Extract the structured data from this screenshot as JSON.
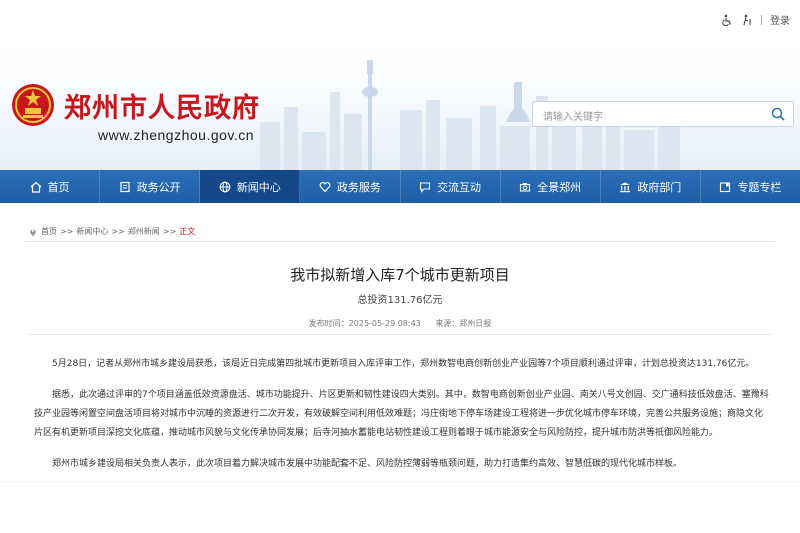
{
  "top_tools": {
    "accessibility_label": "",
    "login_label": "登录"
  },
  "header": {
    "site_title": "郑州市人民政府",
    "site_url": "www.zhengzhou.gov.cn"
  },
  "search": {
    "placeholder": "请输入关键字"
  },
  "nav": {
    "items": [
      {
        "label": "首页",
        "icon": "home-icon"
      },
      {
        "label": "政务公开",
        "icon": "document-icon"
      },
      {
        "label": "新闻中心",
        "icon": "globe-icon"
      },
      {
        "label": "政务服务",
        "icon": "heart-icon"
      },
      {
        "label": "交流互动",
        "icon": "chat-icon"
      },
      {
        "label": "全景郑州",
        "icon": "camera-icon"
      },
      {
        "label": "政府部门",
        "icon": "building-icon"
      },
      {
        "label": "专题专栏",
        "icon": "bookmark-icon"
      }
    ],
    "active_index": 2
  },
  "breadcrumb": {
    "items": [
      "首页",
      "新闻中心",
      "郑州新闻"
    ],
    "separator": ">>",
    "current": "正文"
  },
  "article": {
    "title": "我市拟新增入库7个城市更新项目",
    "subtitle": "总投资131.76亿元",
    "published_label": "发布时间：2025-05-29 08:43",
    "source_label": "来源：郑州日报",
    "paragraphs": [
      "5月28日，记者从郑州市城乡建设局获悉，该局近日完成第四批城市更新项目入库评审工作，郑州数智电商创新创业产业园等7个项目顺利通过评审，计划总投资达131.76亿元。",
      "据悉，此次通过评审的7个项目涵盖低效资源盘活、城市功能提升、片区更新和韧性建设四大类别。其中，数智电商创新创业产业园、南关八号文创园、交广通科技低效盘活、塞豫科技产业园等闲置空间盘活项目将对城市中沉睡的资源进行二次开发，有效破解空间利用低效难题；冯庄街地下停车场建设工程将进一步优化城市停车环境，完善公共服务设施；商隐文化片区有机更新项目深挖文化底蕴，推动城市风貌与文化传承协同发展；后寺河抽水蓄能电站韧性建设工程则着眼于城市能源安全与风险防控，提升城市防洪等抵御风险能力。",
      "郑州市城乡建设局相关负责人表示，此次项目着力解决城市发展中功能配套不足、风险防控薄弱等瓶颈问题，助力打造集约高效、智慧低碳的现代化城市样板。"
    ]
  },
  "colors": {
    "brand_red": "#c8161d",
    "nav_blue": "#2a6fb8",
    "nav_active": "#15488a"
  }
}
